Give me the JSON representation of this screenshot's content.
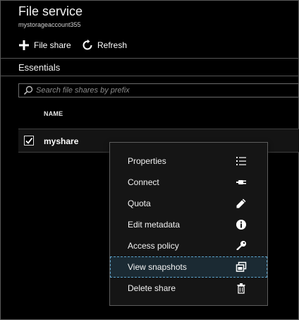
{
  "header": {
    "title": "File service",
    "subtitle": "mystorageaccount355"
  },
  "toolbar": {
    "add_label": "File share",
    "refresh_label": "Refresh"
  },
  "essentials": {
    "label": "Essentials"
  },
  "search": {
    "placeholder": "Search file shares by prefix",
    "value": ""
  },
  "table": {
    "columns": [
      "NAME"
    ],
    "rows": [
      {
        "name": "myshare",
        "checked": true
      }
    ]
  },
  "context_menu": {
    "items": [
      {
        "label": "Properties",
        "icon": "list-icon"
      },
      {
        "label": "Connect",
        "icon": "plug-icon"
      },
      {
        "label": "Quota",
        "icon": "pencil-icon"
      },
      {
        "label": "Edit metadata",
        "icon": "info-icon"
      },
      {
        "label": "Access policy",
        "icon": "key-icon"
      },
      {
        "label": "View snapshots",
        "icon": "snapshots-icon",
        "focused": true
      },
      {
        "label": "Delete share",
        "icon": "trash-icon"
      }
    ]
  },
  "colors": {
    "background": "#000000",
    "border": "#5a5a5a",
    "focus": "#5aa0c8"
  }
}
